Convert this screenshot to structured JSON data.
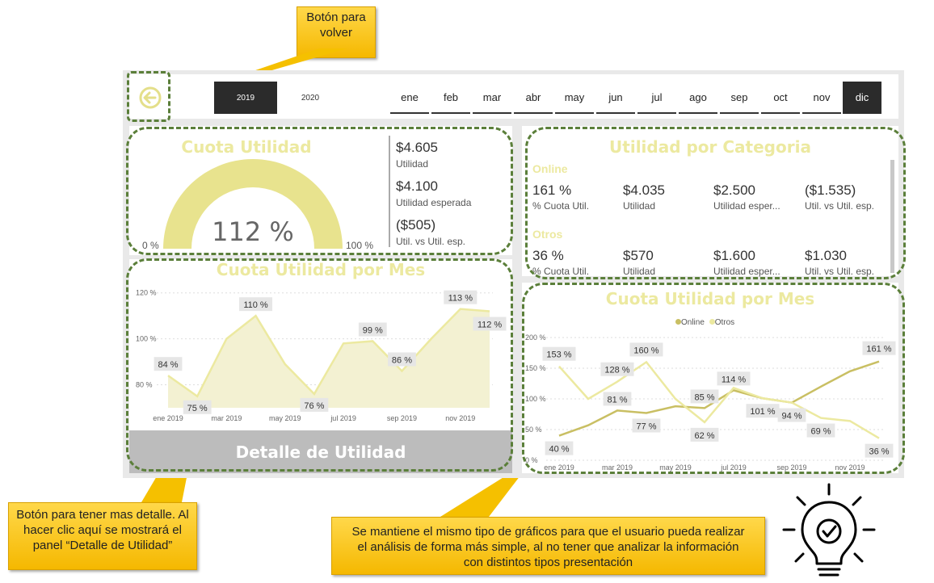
{
  "callouts": {
    "back": "Botón para volver",
    "detail": "Botón para tener mas detalle. Al hacer clic aquí se mostrará el panel “Detalle de Utilidad”",
    "charts": "Se mantiene el mismo tipo de gráficos para que el usuario pueda realizar el análisis de forma más simple, al no tener que analizar la información con distintos tipos presentación"
  },
  "filters": {
    "years": [
      "2019",
      "2020"
    ],
    "selected_year": "2019",
    "months": [
      "ene",
      "feb",
      "mar",
      "abr",
      "may",
      "jun",
      "jul",
      "ago",
      "sep",
      "oct",
      "nov",
      "dic"
    ],
    "selected_month": "dic"
  },
  "cuota_utilidad": {
    "title": "Cuota Utilidad",
    "gauge_value": "112 %",
    "gauge_min": "0 %",
    "gauge_max": "100 %",
    "gauge_fill": 1.0,
    "utilidad_value": "$4.605",
    "utilidad_label": "Utilidad",
    "esperada_value": "$4.100",
    "esperada_label": "Utilidad esperada",
    "diff_value": "($505)",
    "diff_label": "Util. vs Util. esp."
  },
  "categoria": {
    "title": "Utilidad por Categoria",
    "groups": [
      {
        "name": "Online",
        "values": [
          "161 %",
          "$4.035",
          "$2.500",
          "($1.535)"
        ],
        "labels": [
          "% Cuota Util.",
          "Utilidad",
          "Utilidad esper...",
          "Util. vs Util. esp."
        ]
      },
      {
        "name": "Otros",
        "values": [
          "36 %",
          "$570",
          "$1.600",
          "$1.030"
        ],
        "labels": [
          "% Cuota Util.",
          "Utilidad",
          "Utilidad esper...",
          "Util. vs Util. esp."
        ]
      }
    ]
  },
  "detail_button": "Detalle de Utilidad",
  "colors": {
    "accent": "#ece9a0",
    "online": "#c9bf63",
    "otros": "#ece9a0",
    "dash": "#5b7f3a",
    "dark": "#2b2b2b"
  },
  "chart_data": [
    {
      "type": "area",
      "title": "Cuota Utilidad por Mes",
      "x": [
        "ene 2019",
        "feb 2019",
        "mar 2019",
        "abr 2019",
        "may 2019",
        "jun 2019",
        "jul 2019",
        "ago 2019",
        "sep 2019",
        "oct 2019",
        "nov 2019",
        "dic 2019"
      ],
      "x_ticks": [
        "ene 2019",
        "mar 2019",
        "may 2019",
        "jul 2019",
        "sep 2019",
        "nov 2019"
      ],
      "values": [
        84,
        75,
        100,
        110,
        89,
        76,
        98,
        99,
        86,
        100,
        113,
        112
      ],
      "labels": {
        "0": "84 %",
        "1": "75 %",
        "3": "110 %",
        "5": "76 %",
        "7": "99 %",
        "8": "86 %",
        "10": "113 %",
        "11": "112 %"
      },
      "y_ticks": [
        "120 %",
        "100 %",
        "80 %"
      ],
      "ylim": [
        70,
        122
      ],
      "grid": true
    },
    {
      "type": "line",
      "title": "Cuota Utilidad por Mes",
      "x": [
        "ene 2019",
        "feb 2019",
        "mar 2019",
        "abr 2019",
        "may 2019",
        "jun 2019",
        "jul 2019",
        "ago 2019",
        "sep 2019",
        "oct 2019",
        "nov 2019",
        "dic 2019"
      ],
      "x_ticks": [
        "ene 2019",
        "mar 2019",
        "may 2019",
        "jul 2019",
        "sep 2019",
        "nov 2019"
      ],
      "y_ticks": [
        "200 %",
        "150 %",
        "100 %",
        "50 %",
        "0 %"
      ],
      "ylim": [
        0,
        200
      ],
      "legend": "top-center",
      "series": [
        {
          "name": "Online",
          "values": [
            40,
            57,
            81,
            77,
            88,
            85,
            114,
            101,
            94,
            120,
            145,
            161
          ],
          "labels": {
            "0": "40 %",
            "2": "81 %",
            "3": "77 %",
            "5": "85 %",
            "6": "114 %",
            "7": "101 %",
            "11": "161 %"
          }
        },
        {
          "name": "Otros",
          "values": [
            153,
            100,
            128,
            160,
            100,
            62,
            118,
            101,
            94,
            69,
            64,
            36
          ],
          "labels": {
            "0": "153 %",
            "2": "128 %",
            "3": "160 %",
            "5": "62 %",
            "8": "94 %",
            "9": "69 %",
            "11": "36 %"
          }
        }
      ]
    }
  ]
}
